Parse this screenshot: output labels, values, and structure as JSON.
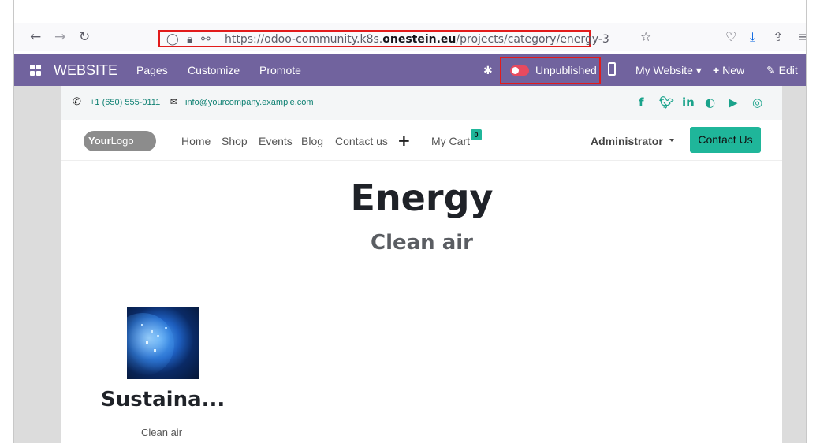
{
  "browser": {
    "url_prefix": "https://odoo-community.k8s.",
    "url_domain": "onestein.eu",
    "url_path": "/projects/category/energy-3",
    "icons": [
      "back-icon",
      "forward-icon",
      "reload-icon",
      "shield-icon",
      "lock-icon",
      "permissions-icon",
      "bookmark-star-icon",
      "pocket-icon",
      "download-icon",
      "share-icon",
      "menu-icon"
    ]
  },
  "odoo_bar": {
    "app_title": "WEBSITE",
    "menu": [
      "Pages",
      "Customize",
      "Promote"
    ],
    "unpublished_label": "Unpublished",
    "my_website_label": "My Website",
    "new_label": "New",
    "edit_label": "Edit",
    "color": "#71639e"
  },
  "site": {
    "topbar": {
      "phone": "+1 (650) 555-0111",
      "email": "info@yourcompany.example.com",
      "social_icons": [
        "facebook-icon",
        "twitter-icon",
        "linkedin-icon",
        "github-icon",
        "youtube-icon",
        "instagram-icon"
      ]
    },
    "nav": {
      "logo_bold": "Your",
      "logo_light": "Logo",
      "links": [
        "Home",
        "Shop",
        "Events",
        "Blog",
        "Contact us"
      ],
      "cart_label": "My Cart",
      "cart_count": "0",
      "user": "Administrator",
      "cta": "Contact Us",
      "accent": "#1fb69a"
    },
    "heading": "Energy",
    "subheading": "Clean air",
    "project": {
      "title": "Sustaina...",
      "subtitle": "Clean air"
    }
  }
}
